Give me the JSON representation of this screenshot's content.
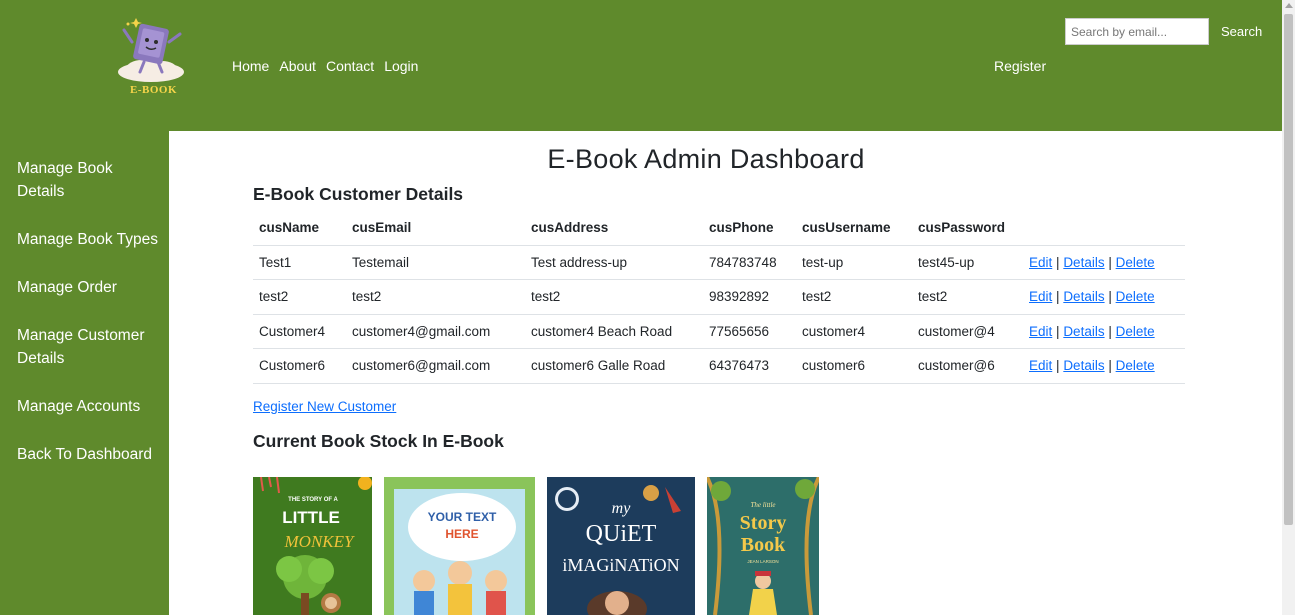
{
  "header": {
    "logo_text": "E-BOOK",
    "nav": [
      "Home",
      "About",
      "Contact",
      "Login"
    ],
    "register_label": "Register",
    "search_placeholder": "Search by email...",
    "search_button": "Search"
  },
  "sidebar": {
    "items": [
      "Manage Book Details",
      "Manage Book Types",
      "Manage Order",
      "Manage Customer Details",
      "Manage Accounts",
      "Back To Dashboard"
    ]
  },
  "main": {
    "title": "E-Book Admin Dashboard",
    "customers_title": "E-Book Customer Details",
    "columns": [
      "cusName",
      "cusEmail",
      "cusAddress",
      "cusPhone",
      "cusUsername",
      "cusPassword"
    ],
    "rows": [
      [
        "Test1",
        "Testemail",
        "Test address-up",
        "784783748",
        "test-up",
        "test45-up"
      ],
      [
        "test2",
        "test2",
        "test2",
        "98392892",
        "test2",
        "test2"
      ],
      [
        "Customer4",
        "customer4@gmail.com",
        "customer4 Beach Road",
        "77565656",
        "customer4",
        "customer@4"
      ],
      [
        "Customer6",
        "customer6@gmail.com",
        "customer6 Galle Road",
        "64376473",
        "customer6",
        "customer@6"
      ]
    ],
    "actions": [
      "Edit",
      "Details",
      "Delete"
    ],
    "register_new_label": "Register New Customer",
    "stock_title": "Current Book Stock In E-Book"
  },
  "books": [
    {
      "title_lines": [
        "THE STORY OF A",
        "LITTLE",
        "MONKEY"
      ]
    },
    {
      "title_lines": [
        "YOUR TEXT",
        "HERE"
      ]
    },
    {
      "title_lines": [
        "my",
        "QUiET",
        "iMAGiNATiON"
      ]
    },
    {
      "title_lines": [
        "The little",
        "Story",
        "Book",
        "JEAN LARSON"
      ]
    }
  ],
  "colors": {
    "header_green": "#5f8a2c",
    "link_blue": "#0d6efd"
  }
}
